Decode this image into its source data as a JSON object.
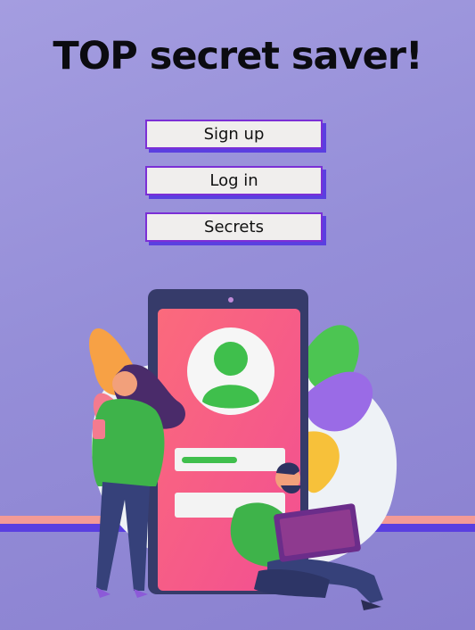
{
  "header": {
    "title": "TOP secret saver!"
  },
  "nav": {
    "buttons": [
      {
        "label": "Sign up"
      },
      {
        "label": "Log in"
      },
      {
        "label": "Secrets"
      }
    ]
  },
  "illustration": {
    "subject": "people-with-phone-login",
    "colors": {
      "background": "#958ed8",
      "phone_frame": "#3a3f6e",
      "phone_screen": "#f5587a",
      "avatar_green": "#3fbf4c",
      "floor_stripe": "#f39a96",
      "floor_band": "#5a3fe0"
    }
  },
  "icons": [
    "user-avatar-icon",
    "phone-camera-icon"
  ]
}
